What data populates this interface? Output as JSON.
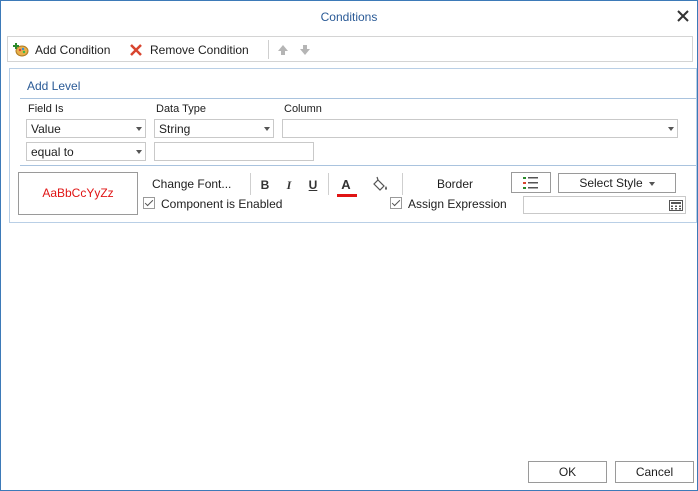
{
  "window": {
    "title": "Conditions"
  },
  "toolbar": {
    "add_condition": "Add Condition",
    "remove_condition": "Remove Condition"
  },
  "level": {
    "title": "Add Level",
    "field_is_label": "Field Is",
    "data_type_label": "Data Type",
    "column_label": "Column",
    "field_is_value": "Value",
    "data_type_value": "String",
    "column_value": "",
    "operator_value": "equal to",
    "compare_value": ""
  },
  "style": {
    "preview_text": "AaBbCcYyZz",
    "change_font": "Change Font...",
    "bold": "B",
    "italic": "I",
    "underline": "U",
    "font_color_letter": "A",
    "border": "Border",
    "select_style": "Select Style",
    "component_enabled": "Component is Enabled",
    "assign_expression": "Assign Expression",
    "expression_value": ""
  },
  "footer": {
    "ok": "OK",
    "cancel": "Cancel"
  },
  "colors": {
    "accent": "#2a5a96",
    "preview_text": "#e01414",
    "font_color_bar": "#e01414"
  }
}
